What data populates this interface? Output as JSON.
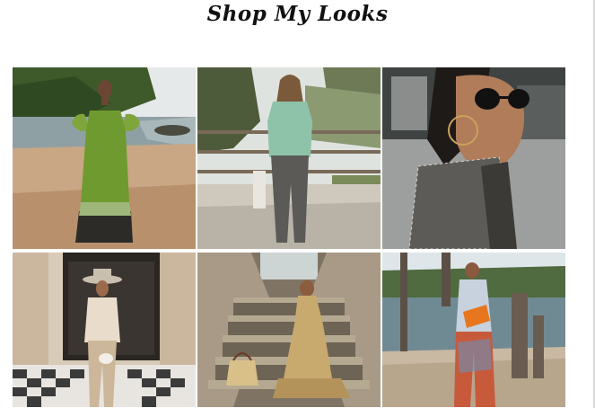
{
  "header": {
    "title": "Shop My Looks"
  },
  "looks": [
    {
      "id": "look-1",
      "scene": "beach"
    },
    {
      "id": "look-2",
      "scene": "boardwalk"
    },
    {
      "id": "look-3",
      "scene": "street-closeup"
    },
    {
      "id": "look-4",
      "scene": "doorway"
    },
    {
      "id": "look-5",
      "scene": "stairs"
    },
    {
      "id": "look-6",
      "scene": "pier"
    }
  ]
}
